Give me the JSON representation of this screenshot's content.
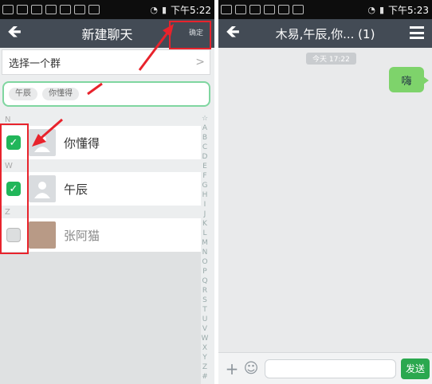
{
  "left": {
    "status": {
      "time": "下午5:22"
    },
    "title": "新建聊天",
    "confirm_label": "确定",
    "select_group": "选择一个群",
    "chips": [
      "午辰",
      "你懂得"
    ],
    "sections": [
      {
        "letter": "N",
        "contacts": [
          {
            "name": "你懂得",
            "checked": true
          }
        ]
      },
      {
        "letter": "W",
        "contacts": [
          {
            "name": "午辰",
            "checked": true
          }
        ]
      },
      {
        "letter": "Z",
        "contacts": [
          {
            "name": "张阿猫",
            "checked": false
          }
        ]
      }
    ],
    "index_letters": [
      "☆",
      "A",
      "B",
      "C",
      "D",
      "E",
      "F",
      "G",
      "H",
      "I",
      "J",
      "K",
      "L",
      "M",
      "N",
      "O",
      "P",
      "Q",
      "R",
      "S",
      "T",
      "U",
      "V",
      "W",
      "X",
      "Y",
      "Z",
      "#"
    ]
  },
  "right": {
    "status": {
      "time": "下午5:23"
    },
    "title": "木易,午辰,你... (1)",
    "msg_time": "今天 17:22",
    "bubble_text": "嗨",
    "input_placeholder": "",
    "send_label": "发送"
  },
  "colors": {
    "titlebar": "#434b55",
    "accent_green": "#21b65a",
    "bubble_green": "#7ed36b",
    "highlight_red": "#e8232c"
  }
}
